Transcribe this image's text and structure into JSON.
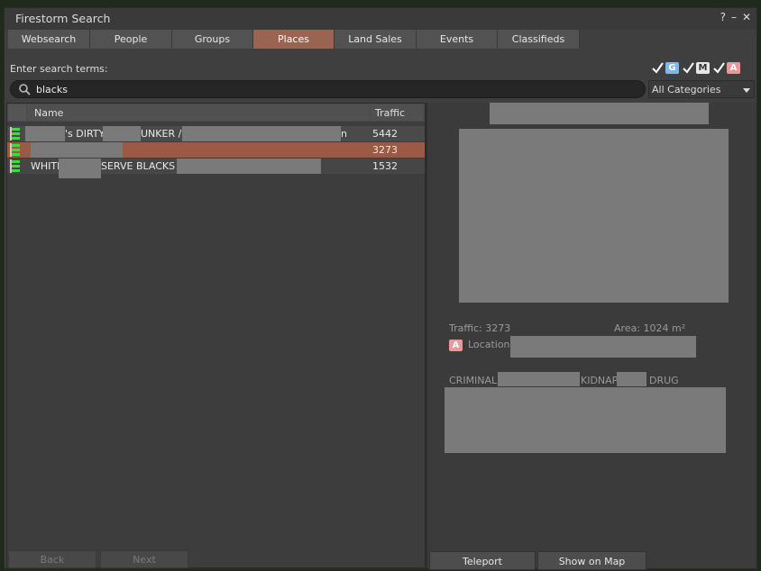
{
  "window": {
    "title": "Firestorm Search"
  },
  "titlebar_icons": {
    "help": "?",
    "minimize": "–",
    "close": "✕"
  },
  "tabs": [
    {
      "label": "Websearch",
      "active": false
    },
    {
      "label": "People",
      "active": false
    },
    {
      "label": "Groups",
      "active": false
    },
    {
      "label": "Places",
      "active": true
    },
    {
      "label": "Land Sales",
      "active": false
    },
    {
      "label": "Events",
      "active": false
    },
    {
      "label": "Classifieds",
      "active": false
    }
  ],
  "search": {
    "label": "Enter search terms:",
    "value": "blacks"
  },
  "maturity_filters": [
    {
      "badge": "G",
      "checked": true
    },
    {
      "badge": "M",
      "checked": true
    },
    {
      "badge": "A",
      "checked": true
    }
  ],
  "category": {
    "selected": "All Categories"
  },
  "results": {
    "columns": {
      "name": "Name",
      "traffic": "Traffic"
    },
    "rows": [
      {
        "name_parts": [
          "'s DIRTY",
          "UNKER /",
          "n"
        ],
        "traffic": "5442",
        "selected": false
      },
      {
        "name_parts": [],
        "traffic": "3273",
        "selected": true
      },
      {
        "name_parts": [
          "WHITE",
          "SERVE BLACKS -"
        ],
        "traffic": "1532",
        "selected": false
      }
    ]
  },
  "pager": {
    "back": "Back",
    "next": "Next"
  },
  "details": {
    "traffic": "Traffic: 3273",
    "area": "Area: 1024 m²",
    "maturity_badge": "A",
    "location_label": "Location",
    "description_parts": [
      "CRIMINAL",
      "KIDNAP",
      "DRUG"
    ]
  },
  "actions": {
    "teleport": "Teleport",
    "show_on_map": "Show on Map"
  },
  "colors": {
    "accent": "#9a6550",
    "selected_row": "#9a5a43",
    "panel": "#3f3f3f"
  }
}
